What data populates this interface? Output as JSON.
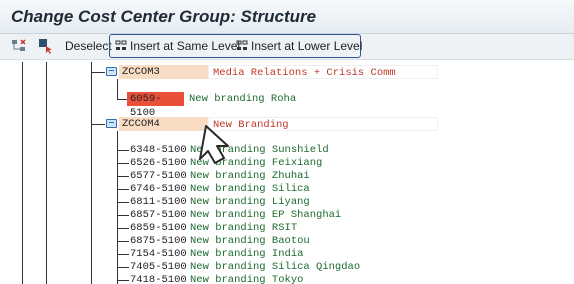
{
  "title": "Change Cost Center Group: Structure",
  "toolbar": {
    "deselect_label": "Deselect",
    "insert_same_label": "Insert at Same Level",
    "insert_lower_label": "Insert at Lower Level"
  },
  "tree": {
    "group1": {
      "code": "ZCCOM3",
      "description": "Media Relations + Crisis Comm"
    },
    "group1_leaf": {
      "code": "6059-5100",
      "description": "New branding Roha"
    },
    "group2": {
      "code": "ZCCOM4",
      "description": "New Branding"
    },
    "leaves": [
      {
        "code": "6348-5100",
        "description": "New branding Sunshield"
      },
      {
        "code": "6526-5100",
        "description": "New branding Feixiang"
      },
      {
        "code": "6577-5100",
        "description": "New branding Zhuhai"
      },
      {
        "code": "6746-5100",
        "description": "New branding Silica"
      },
      {
        "code": "6811-5100",
        "description": "New branding Liyang"
      },
      {
        "code": "6857-5100",
        "description": "New branding EP Shanghai"
      },
      {
        "code": "6859-5100",
        "description": "New branding RSIT"
      },
      {
        "code": "6875-5100",
        "description": "New branding Baotou"
      },
      {
        "code": "7154-5100",
        "description": "New branding India"
      },
      {
        "code": "7405-5100",
        "description": "New branding Silica Qingdao"
      },
      {
        "code": "7418-5100",
        "description": "New branding Tokyo"
      }
    ]
  },
  "colors": {
    "group_code_bg": "#f9dcc4",
    "selected_leaf_bg": "#e8503a",
    "group_desc_color": "#c0392b",
    "leaf_desc_color": "#1e6b2e",
    "toolbar_highlight": "#2f5597"
  },
  "icons": [
    "select-subtree-icon",
    "select-block-icon",
    "insert-same-level-icon",
    "insert-lower-level-icon",
    "folder-icon",
    "mouse-cursor-icon"
  ]
}
